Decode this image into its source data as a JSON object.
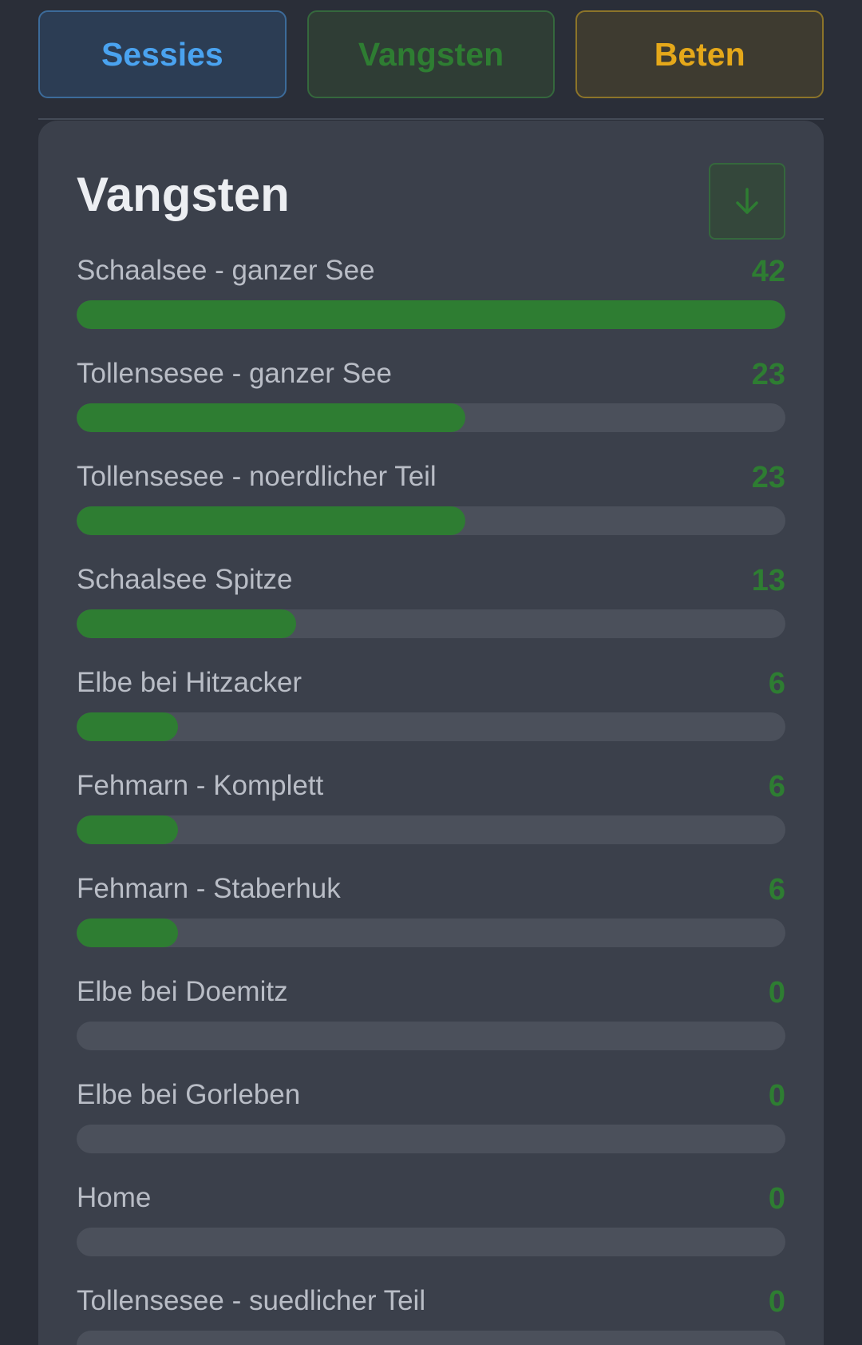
{
  "tabs": {
    "sessies": "Sessies",
    "vangsten": "Vangsten",
    "beten": "Beten"
  },
  "card": {
    "title": "Vangsten",
    "download_icon": "arrow-down-icon"
  },
  "colors": {
    "accent_green": "#2e7d32",
    "accent_blue": "#4aa3f0",
    "accent_amber": "#e5a81a"
  },
  "catches": [
    {
      "label": "Schaalsee - ganzer See",
      "value": "42",
      "fraction": 1.0
    },
    {
      "label": "Tollensesee - ganzer See",
      "value": "23",
      "fraction": 0.548
    },
    {
      "label": "Tollensesee - noerdlicher Teil",
      "value": "23",
      "fraction": 0.548
    },
    {
      "label": "Schaalsee Spitze",
      "value": "13",
      "fraction": 0.31
    },
    {
      "label": "Elbe bei Hitzacker",
      "value": "6",
      "fraction": 0.143
    },
    {
      "label": "Fehmarn - Komplett",
      "value": "6",
      "fraction": 0.143
    },
    {
      "label": "Fehmarn - Staberhuk",
      "value": "6",
      "fraction": 0.143
    },
    {
      "label": "Elbe bei Doemitz",
      "value": "0",
      "fraction": 0
    },
    {
      "label": "Elbe bei Gorleben",
      "value": "0",
      "fraction": 0
    },
    {
      "label": "Home",
      "value": "0",
      "fraction": 0
    },
    {
      "label": "Tollensesee - suedlicher Teil",
      "value": "0",
      "fraction": 0
    }
  ]
}
